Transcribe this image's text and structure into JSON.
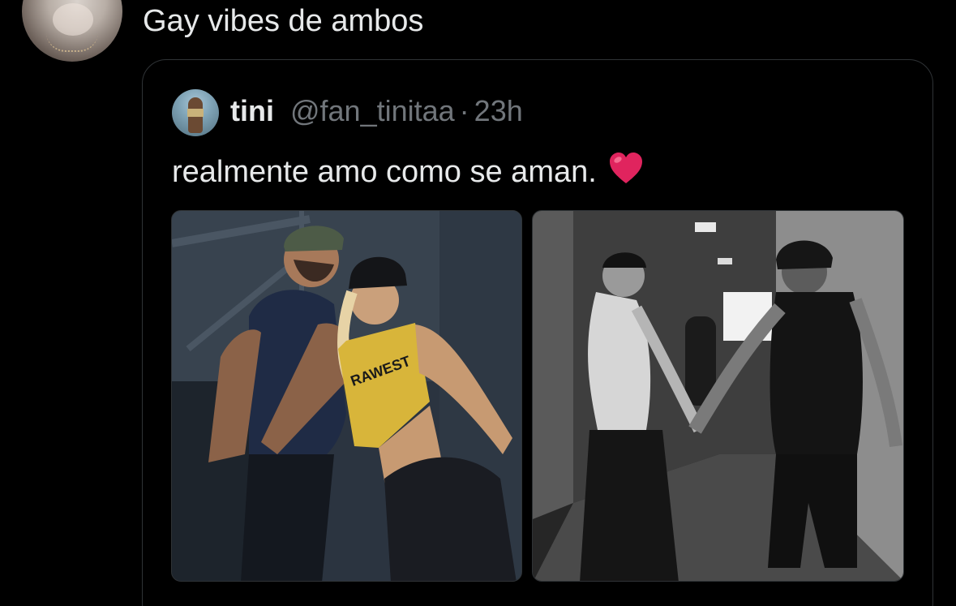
{
  "tweet": {
    "text": "Gay vibes de ambos"
  },
  "quoted": {
    "name": "tini",
    "handle": "@fan_tinitaa",
    "separator": "·",
    "time": "23h",
    "text": "realmente amo como se aman.",
    "emoji": "red-heart"
  },
  "media": [
    {
      "kind": "photo",
      "tone": "color",
      "shirt_text": "RAWEST"
    },
    {
      "kind": "photo",
      "tone": "black-and-white"
    }
  ],
  "colors": {
    "background": "#000000",
    "text_primary": "#e7e9ea",
    "text_secondary": "#71767b",
    "border": "#2f3336",
    "heart": "#e0245e"
  }
}
